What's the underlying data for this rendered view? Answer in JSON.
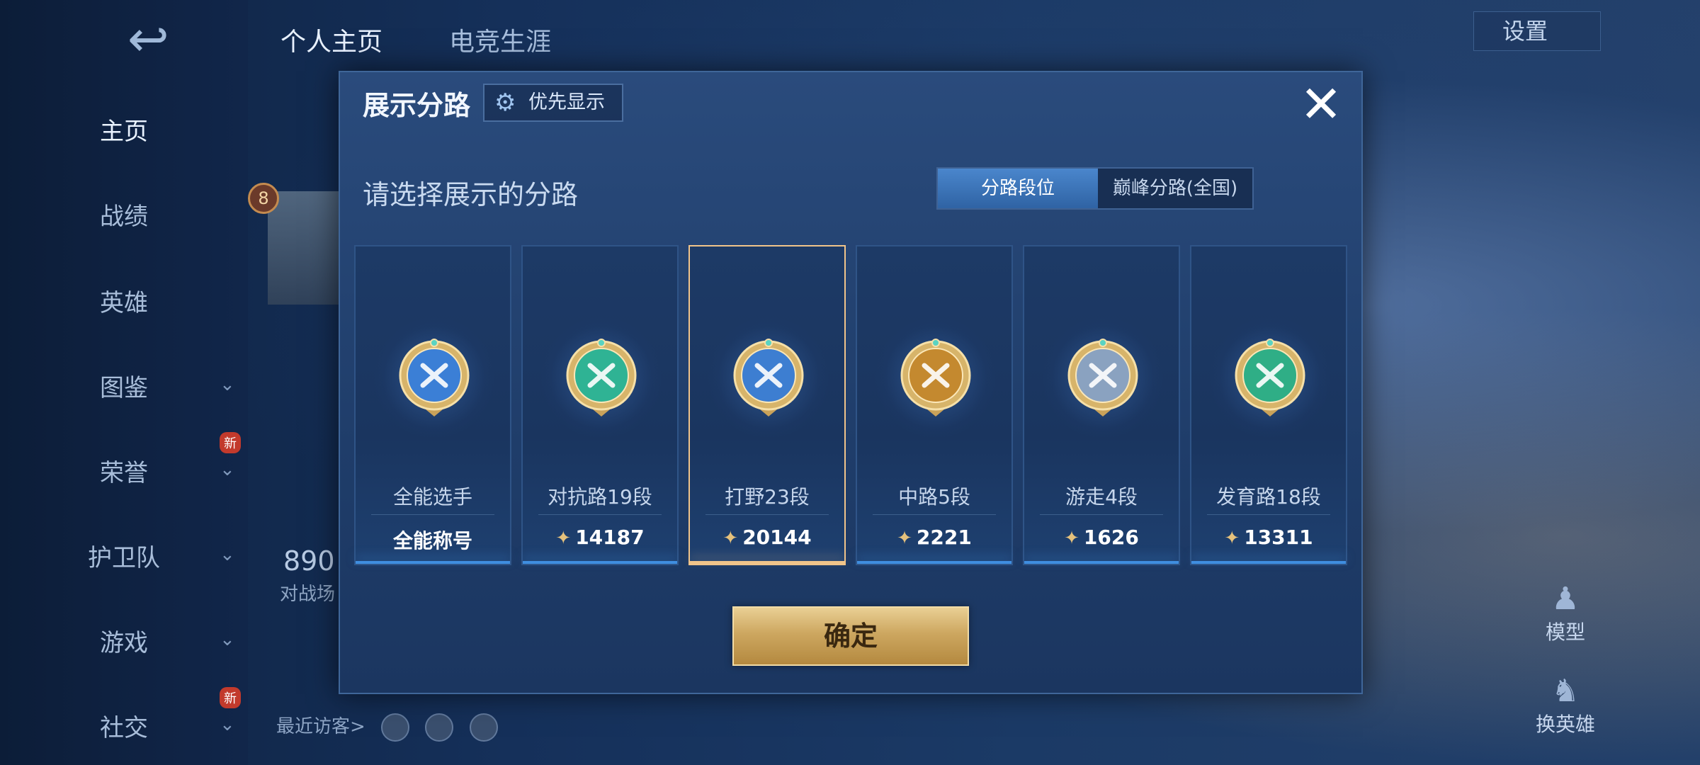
{
  "background": {
    "top_tabs": [
      "个人主页",
      "电竞生涯"
    ],
    "settings_label": "设置",
    "sidebar": [
      {
        "label": "主页",
        "active": true
      },
      {
        "label": "战绩"
      },
      {
        "label": "英雄"
      },
      {
        "label": "图鉴",
        "chevron": true
      },
      {
        "label": "荣誉",
        "chevron": true,
        "new": "新"
      },
      {
        "label": "护卫队",
        "chevron": true
      },
      {
        "label": "游戏",
        "chevron": true
      },
      {
        "label": "社交",
        "chevron": true,
        "new": "新"
      }
    ],
    "level": "8",
    "stats_number": "890",
    "stats_label": "对战场",
    "recent_visitors": "最近访客>",
    "right_buttons": {
      "model": "模型",
      "swap_hero": "换英雄"
    }
  },
  "modal": {
    "title": "展示分路",
    "priority_label": "优先显示",
    "close_symbol": "✕",
    "subtitle": "请选择展示的分路",
    "toggle": {
      "active": "分路段位",
      "inactive": "巅峰分路(全国)"
    },
    "confirm_label": "确定",
    "cards": [
      {
        "name": "全能选手",
        "value": "全能称号",
        "has_icon": false,
        "emblem_color": "#3b7fd6",
        "selected": false
      },
      {
        "name": "对抗路19段",
        "value": "14187",
        "has_icon": true,
        "emblem_color": "#2fb394",
        "selected": false
      },
      {
        "name": "打野23段",
        "value": "20144",
        "has_icon": true,
        "emblem_color": "#3d7ed1",
        "selected": true
      },
      {
        "name": "中路5段",
        "value": "2221",
        "has_icon": true,
        "emblem_color": "#c4892f",
        "selected": false
      },
      {
        "name": "游走4段",
        "value": "1626",
        "has_icon": true,
        "emblem_color": "#8aa2c0",
        "selected": false
      },
      {
        "name": "发育路18段",
        "value": "13311",
        "has_icon": true,
        "emblem_color": "#2fae86",
        "selected": false
      }
    ]
  }
}
